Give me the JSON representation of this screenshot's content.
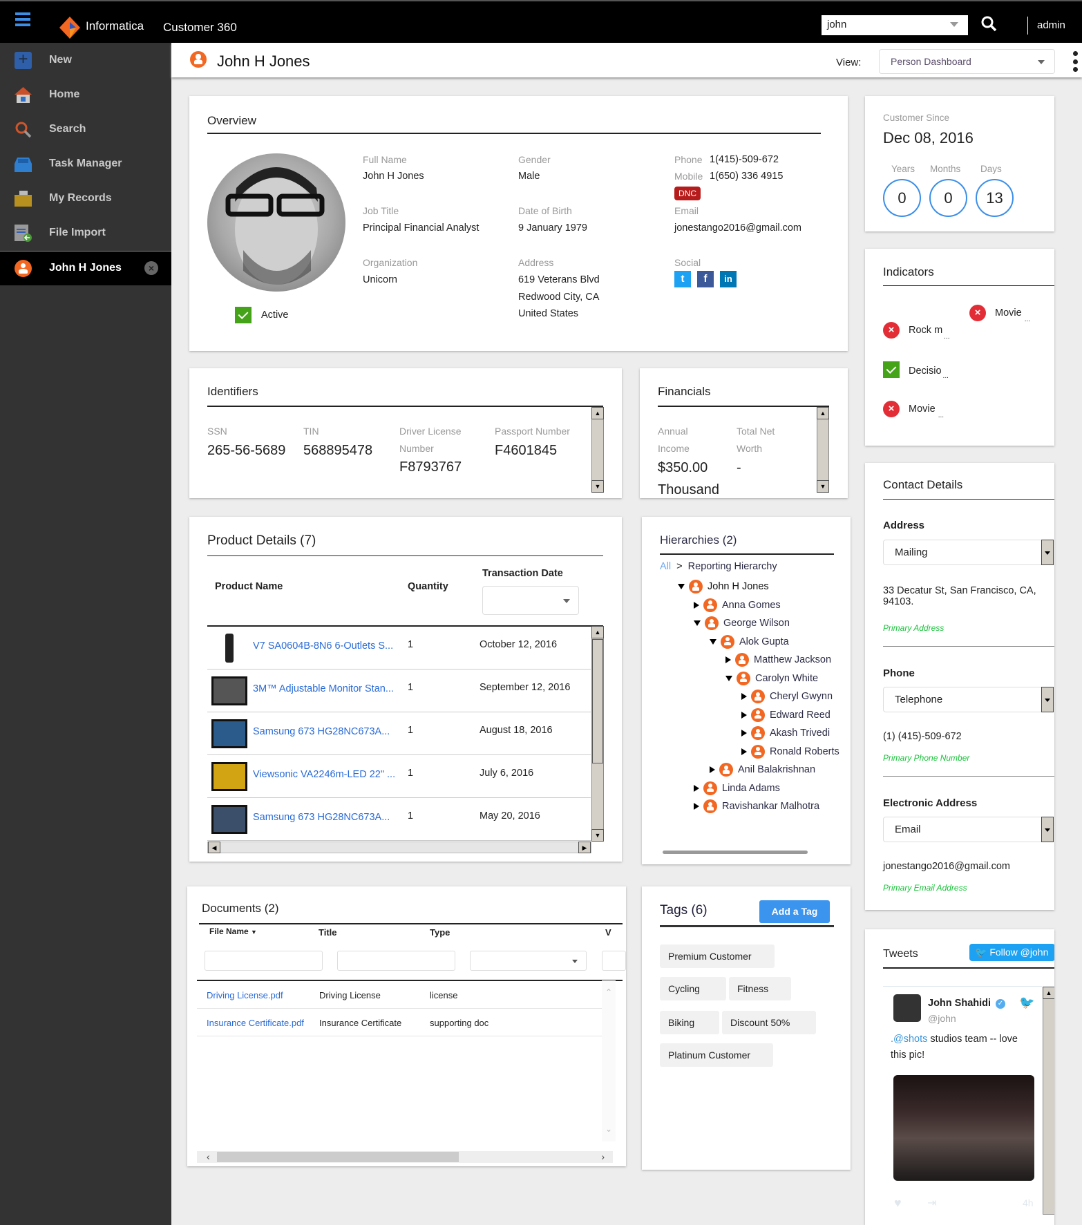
{
  "topbar": {
    "brand": "Informatica",
    "app_title": "Customer 360",
    "search_value": "john",
    "user": "admin",
    "icons": {
      "menu": "hamburger-icon",
      "search": "search-icon",
      "logo": "informatica-logo"
    }
  },
  "sidebar": {
    "items": [
      {
        "label": "New",
        "icon": "plus-icon"
      },
      {
        "label": "Home",
        "icon": "home-icon"
      },
      {
        "label": "Search",
        "icon": "search-icon"
      },
      {
        "label": "Task Manager",
        "icon": "inbox-icon"
      },
      {
        "label": "My Records",
        "icon": "folder-icon"
      },
      {
        "label": "File Import",
        "icon": "file-import-icon"
      }
    ],
    "active_record": {
      "label": "John H Jones",
      "icon": "person-icon",
      "close": "×"
    }
  },
  "header": {
    "title": "John H Jones",
    "view_label": "View:",
    "view_value": "Person Dashboard"
  },
  "overview": {
    "title": "Overview",
    "status": "Active",
    "full_name_label": "Full Name",
    "full_name": "John H Jones",
    "gender_label": "Gender",
    "gender": "Male",
    "phone_label": "Phone",
    "phone": "1(415)-509-672",
    "mobile_label": "Mobile",
    "mobile": "1(650) 336 4915",
    "dnc": "DNC",
    "job_title_label": "Job Title",
    "job_title": "Principal Financial Analyst",
    "dob_label": "Date of Birth",
    "dob": "9 January 1979",
    "email_label": "Email",
    "email": "jonestango2016@gmail.com",
    "org_label": "Organization",
    "org": "Unicorn",
    "address_label": "Address",
    "address_lines": [
      "619 Veterans Blvd",
      "Redwood City, CA",
      "United States"
    ],
    "social_label": "Social",
    "social": [
      "twitter",
      "facebook",
      "linkedin"
    ]
  },
  "customer_since": {
    "label": "Customer Since",
    "date": "Dec 08, 2016",
    "years_label": "Years",
    "years": "0",
    "months_label": "Months",
    "months": "0",
    "days_label": "Days",
    "days": "13"
  },
  "indicators": {
    "title": "Indicators",
    "items": [
      {
        "label": "Movie",
        "status": "fail"
      },
      {
        "label": "Rock m",
        "status": "fail"
      },
      {
        "label": "Decisio",
        "status": "pass"
      },
      {
        "label": "Movie",
        "status": "fail"
      }
    ],
    "ellipsis": "..."
  },
  "identifiers": {
    "title": "Identifiers",
    "ssn_label": "SSN",
    "ssn": "265-56-5689",
    "tin_label": "TIN",
    "tin": "568895478",
    "dl_label_1": "Driver License",
    "dl_label_2": "Number",
    "dl": "F8793767",
    "passport_label": "Passport Number",
    "passport": "F4601845"
  },
  "financials": {
    "title": "Financials",
    "income_label_1": "Annual",
    "income_label_2": "Income",
    "income": "$350.00",
    "income_unit": "Thousand",
    "networth_label_1": "Total Net",
    "networth_label_2": "Worth",
    "networth": "-"
  },
  "products": {
    "title": "Product Details (7)",
    "col_name": "Product Name",
    "col_qty": "Quantity",
    "col_date": "Transaction Date",
    "rows": [
      {
        "name": "V7 SA0604B-8N6 6-Outlets S...",
        "qty": "1",
        "date": "October 12, 2016"
      },
      {
        "name": "3M™ Adjustable Monitor Stan...",
        "qty": "1",
        "date": "September 12, 2016"
      },
      {
        "name": "Samsung 673 HG28NC673A...",
        "qty": "1",
        "date": "August 18, 2016"
      },
      {
        "name": "Viewsonic VA2246m-LED 22\" ...",
        "qty": "1",
        "date": "July 6, 2016"
      },
      {
        "name": "Samsung 673 HG28NC673A...",
        "qty": "1",
        "date": "May 20, 2016"
      }
    ]
  },
  "hierarchies": {
    "title": "Hierarchies (2)",
    "crumb_all": "All",
    "crumb_sep": ">",
    "crumb_current": "Reporting Hierarchy",
    "nodes": [
      {
        "label": "John H Jones",
        "level": 0,
        "open": true
      },
      {
        "label": "Anna Gomes",
        "level": 1,
        "open": false
      },
      {
        "label": "George Wilson",
        "level": 1,
        "open": true
      },
      {
        "label": "Alok Gupta",
        "level": 2,
        "open": true
      },
      {
        "label": "Matthew Jackson",
        "level": 3,
        "open": false
      },
      {
        "label": "Carolyn White",
        "level": 3,
        "open": true
      },
      {
        "label": "Cheryl Gwynn",
        "level": 4,
        "open": false
      },
      {
        "label": "Edward Reed",
        "level": 4,
        "open": false
      },
      {
        "label": "Akash Trivedi",
        "level": 4,
        "open": false
      },
      {
        "label": "Ronald Roberts",
        "level": 4,
        "open": false
      },
      {
        "label": "Anil Balakrishnan",
        "level": 2,
        "open": false
      },
      {
        "label": "Linda Adams",
        "level": 1,
        "open": false
      },
      {
        "label": "Ravishankar Malhotra",
        "level": 1,
        "open": false
      }
    ]
  },
  "contact": {
    "title": "Contact Details",
    "address_label": "Address",
    "address_type": "Mailing",
    "address_value": "33 Decatur St, San Francisco, CA, 94103.",
    "address_note": "Primary Address",
    "phone_label": "Phone",
    "phone_type": "Telephone",
    "phone_value": "(1) (415)-509-672",
    "phone_note": "Primary Phone Number",
    "eaddr_label": "Electronic Address",
    "eaddr_type": "Email",
    "eaddr_value": "jonestango2016@gmail.com",
    "eaddr_note": "Primary Email Address"
  },
  "documents": {
    "title": "Documents (2)",
    "col_file": "File Name",
    "col_title": "Title",
    "col_type": "Type",
    "col_more": "V",
    "rows": [
      {
        "file": "Driving License.pdf",
        "title": "Driving License",
        "type": "license"
      },
      {
        "file": "Insurance Certificate.pdf",
        "title": "Insurance Certificate",
        "type": "supporting doc"
      }
    ]
  },
  "tags": {
    "title": "Tags (6)",
    "add_button": "Add a Tag",
    "items": [
      "Premium Customer",
      "Cycling",
      "Fitness",
      "Biking",
      "Discount 50%",
      "Platinum Customer"
    ]
  },
  "tweets": {
    "title": "Tweets",
    "follow_button": "Follow @john",
    "author": "John Shahidi",
    "handle": "@john",
    "mention": ".@shots",
    "text": " studios team -- love this pic!",
    "time": "4h"
  }
}
